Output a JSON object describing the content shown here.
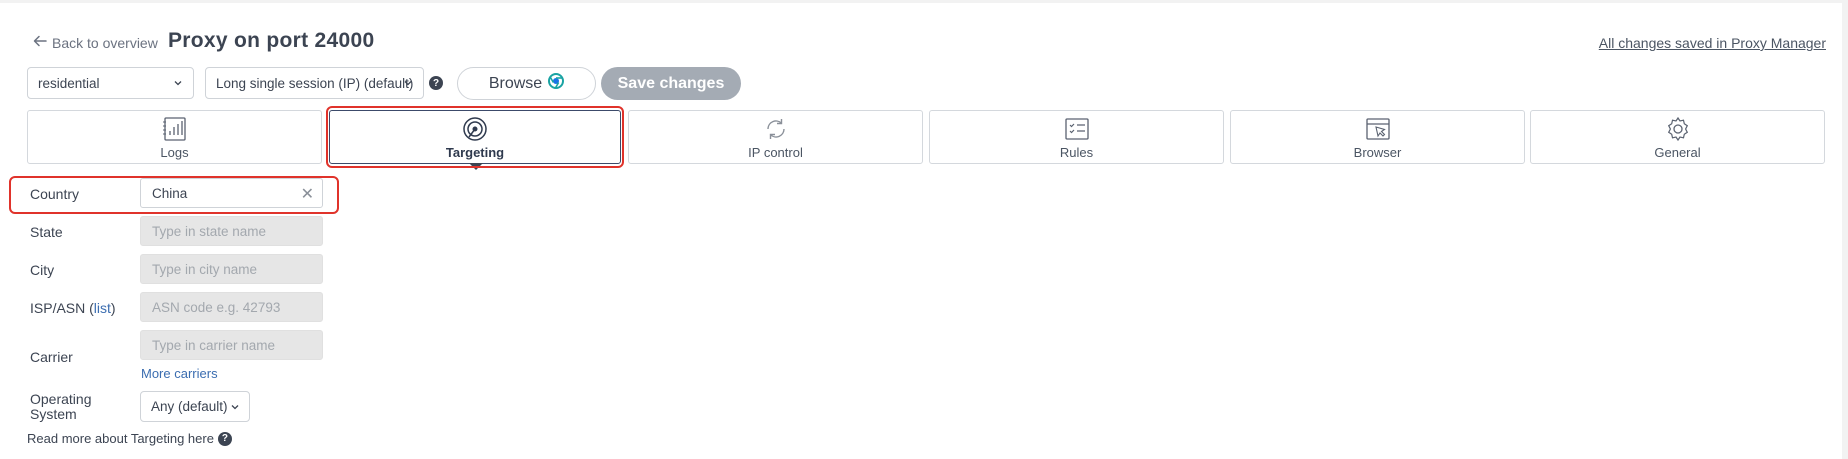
{
  "header": {
    "back_label": "Back to overview",
    "title": "Proxy on port 24000",
    "saved_status": "All changes saved in Proxy Manager"
  },
  "toolbar": {
    "zone_value": "residential",
    "session_value": "Long single session (IP) (default)",
    "browse_label": "Browse",
    "save_label": "Save changes"
  },
  "tabs": [
    {
      "label": "Logs",
      "icon": "logs-icon"
    },
    {
      "label": "Targeting",
      "icon": "targeting-icon",
      "active": true
    },
    {
      "label": "IP control",
      "icon": "refresh-icon"
    },
    {
      "label": "Rules",
      "icon": "rules-icon"
    },
    {
      "label": "Browser",
      "icon": "browser-icon"
    },
    {
      "label": "General",
      "icon": "gear-icon"
    }
  ],
  "form": {
    "country": {
      "label": "Country",
      "value": "China"
    },
    "state": {
      "label": "State",
      "placeholder": "Type in state name"
    },
    "city": {
      "label": "City",
      "placeholder": "Type in city name"
    },
    "asn": {
      "label_prefix": "ISP/ASN (",
      "label_link": "list",
      "label_suffix": ")",
      "placeholder": "ASN code e.g. 42793"
    },
    "carrier": {
      "label": "Carrier",
      "placeholder": "Type in carrier name",
      "more_link": "More carriers"
    },
    "os": {
      "label_line1": "Operating",
      "label_line2": "System",
      "value": "Any (default)"
    },
    "read_more": "Read more about Targeting here"
  },
  "colors": {
    "accent_red": "#e0332b",
    "link": "#3b6db0",
    "save_button": "#a4abb4",
    "text": "#3c4452"
  }
}
